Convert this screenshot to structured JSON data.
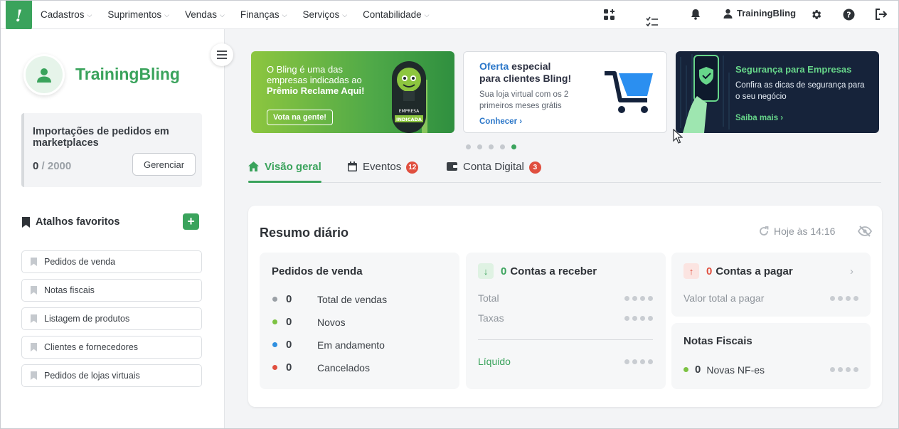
{
  "nav": {
    "logo_text": "!",
    "menu": [
      {
        "label": "Cadastros"
      },
      {
        "label": "Suprimentos"
      },
      {
        "label": "Vendas"
      },
      {
        "label": "Finanças"
      },
      {
        "label": "Serviços"
      },
      {
        "label": "Contabilidade"
      }
    ],
    "user_name": "TrainingBling",
    "icons": [
      "apps-icon",
      "checklist-icon",
      "bell-icon",
      "user-icon",
      "gear-icon",
      "help-icon",
      "logout-icon"
    ]
  },
  "sidebar": {
    "company_name": "TrainingBling",
    "import": {
      "title": "Importações de pedidos em marketplaces",
      "current": "0",
      "separator": "/",
      "total": "2000",
      "manage_label": "Gerenciar"
    },
    "shortcuts_title": "Atalhos favoritos",
    "add_label": "+",
    "shortcuts": [
      {
        "label": "Pedidos de venda"
      },
      {
        "label": "Notas fiscais"
      },
      {
        "label": "Listagem de produtos"
      },
      {
        "label": "Clientes e fornecedores"
      },
      {
        "label": "Pedidos de lojas virtuais"
      }
    ]
  },
  "banners": {
    "b1": {
      "line1": "O Bling é uma das",
      "line2": "empresas indicadas ao",
      "line3": "Prêmio Reclame Aqui!",
      "cta": "Vota na gente!",
      "badge_line1": "EMPRESA",
      "badge_line2": "INDICADA"
    },
    "b2": {
      "highlight": "Oferta",
      "title_rest": "especial",
      "title_line2": "para clientes Bling!",
      "desc": "Sua loja virtual com os 2 primeiros meses grátis",
      "cta": "Conhecer"
    },
    "b3": {
      "title": "Segurança para Empresas",
      "desc": "Confira as dicas de segurança para o seu negócio",
      "cta": "Saiba mais"
    },
    "dots_count": 5,
    "active_dot": 4
  },
  "tabs": [
    {
      "label": "Visão geral",
      "badge": null
    },
    {
      "label": "Eventos",
      "badge": "12"
    },
    {
      "label": "Conta Digital",
      "badge": "3"
    }
  ],
  "summary": {
    "title": "Resumo diário",
    "refresh_label": "Hoje às 14:16",
    "sales": {
      "title": "Pedidos de venda",
      "rows": [
        {
          "value": "0",
          "label": "Total de vendas",
          "color": "#9aa0a6"
        },
        {
          "value": "0",
          "label": "Novos",
          "color": "#7cc242"
        },
        {
          "value": "0",
          "label": "Em andamento",
          "color": "#2f8fe0"
        },
        {
          "value": "0",
          "label": "Cancelados",
          "color": "#e04f3f"
        }
      ]
    },
    "receivable": {
      "count": "0",
      "title": "Contas a receber",
      "total_label": "Total",
      "fees_label": "Taxas",
      "net_label": "Líquido"
    },
    "payable": {
      "count": "0",
      "title": "Contas a pagar",
      "total_label": "Valor total a pagar"
    },
    "invoices": {
      "title": "Notas Fiscais",
      "count": "0",
      "label": "Novas NF-es"
    }
  },
  "colors": {
    "brand": "#3aa35c",
    "danger": "#e04f3f",
    "link": "#2b77c9"
  }
}
